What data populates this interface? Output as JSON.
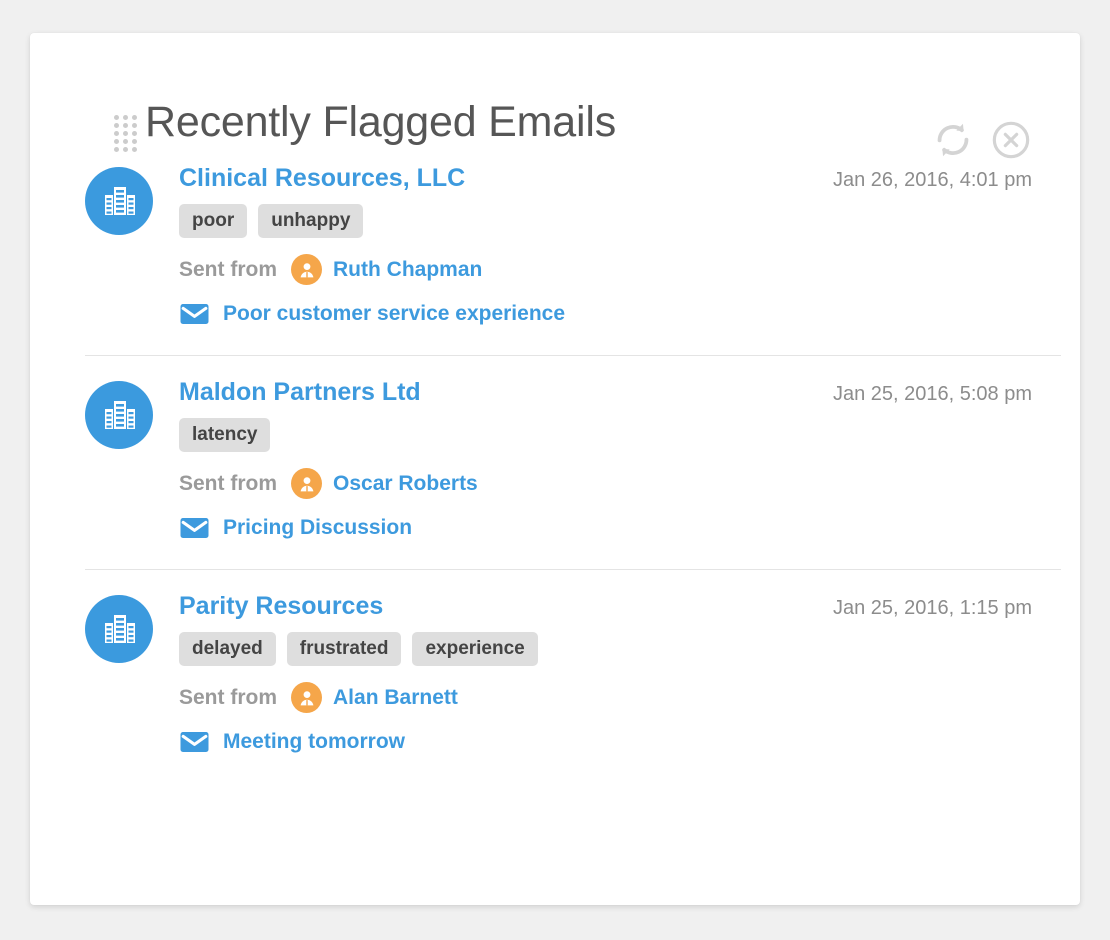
{
  "panel": {
    "title": "Recently Flagged Emails",
    "drag_handle_icon": "drag-dots-icon",
    "refresh_icon": "refresh-icon",
    "close_icon": "close-circle-icon",
    "accent_blue": "#3d9ade",
    "avatar_orange": "#f5a64a",
    "tag_background": "#dedede",
    "page_background": "#f0f0f0"
  },
  "labels": {
    "sent_from": "Sent from"
  },
  "emails": [
    {
      "org_icon": "building-icon",
      "organization": "Clinical Resources, LLC",
      "timestamp": "Jan 26, 2016, 4:01 pm",
      "tags": [
        "poor",
        "unhappy"
      ],
      "sent_from": "Sent from",
      "sender_icon": "user-icon",
      "sender": "Ruth Chapman",
      "subject_icon": "envelope-icon",
      "subject": "Poor customer service experience"
    },
    {
      "org_icon": "building-icon",
      "organization": "Maldon Partners Ltd",
      "timestamp": "Jan 25, 2016, 5:08 pm",
      "tags": [
        "latency"
      ],
      "sent_from": "Sent from",
      "sender_icon": "user-icon",
      "sender": "Oscar Roberts",
      "subject_icon": "envelope-icon",
      "subject": "Pricing Discussion"
    },
    {
      "org_icon": "building-icon",
      "organization": "Parity Resources",
      "timestamp": "Jan 25, 2016, 1:15 pm",
      "tags": [
        "delayed",
        "frustrated",
        "experience"
      ],
      "sent_from": "Sent from",
      "sender_icon": "user-icon",
      "sender": "Alan Barnett",
      "subject_icon": "envelope-icon",
      "subject": "Meeting tomorrow"
    }
  ]
}
